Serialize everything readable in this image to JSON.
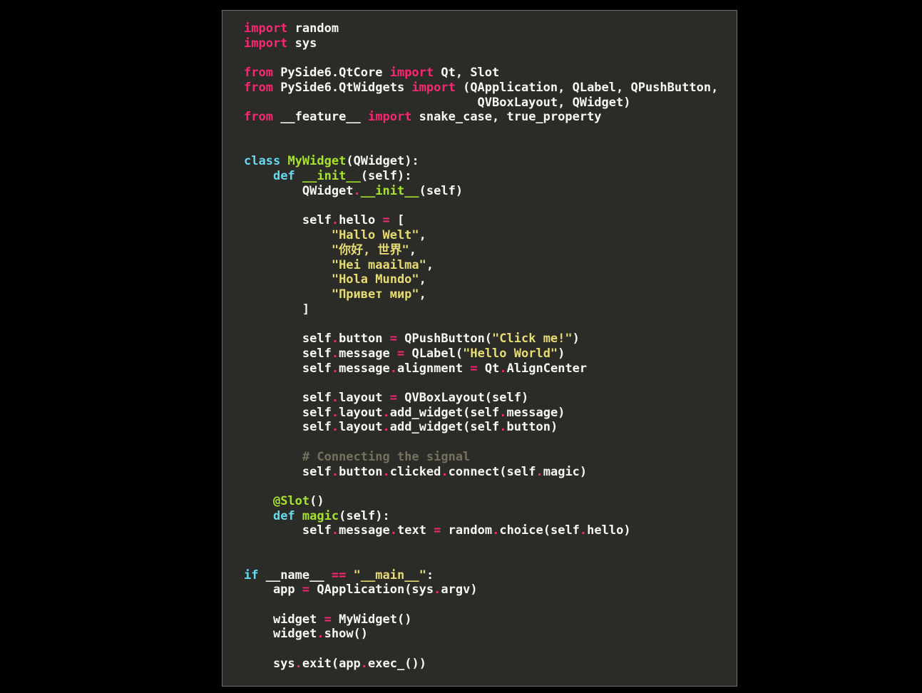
{
  "window": {
    "background_color": "#000000",
    "panel_background_color": "#2b2b28",
    "panel_border_color": "#6f706a"
  },
  "theme": {
    "name": "monokai",
    "keyword_color": "#f92672",
    "control_color": "#66d9ef",
    "function_name_color": "#a6e22e",
    "string_color": "#e6db74",
    "comment_color": "#75715e",
    "plain_color": "#f8f8f2"
  },
  "code": {
    "language": "python",
    "lines": [
      [
        {
          "t": "import",
          "c": "kw"
        },
        {
          "t": " random",
          "c": "pln"
        }
      ],
      [
        {
          "t": "import",
          "c": "kw"
        },
        {
          "t": " sys",
          "c": "pln"
        }
      ],
      [],
      [
        {
          "t": "from",
          "c": "kw"
        },
        {
          "t": " PySide6.QtCore ",
          "c": "pln"
        },
        {
          "t": "import",
          "c": "kw"
        },
        {
          "t": " Qt, Slot",
          "c": "pln"
        }
      ],
      [
        {
          "t": "from",
          "c": "kw"
        },
        {
          "t": " PySide6.QtWidgets ",
          "c": "pln"
        },
        {
          "t": "import",
          "c": "kw"
        },
        {
          "t": " (QApplication, QLabel, QPushButton,",
          "c": "pln"
        }
      ],
      [
        {
          "t": "                                QVBoxLayout, QWidget)",
          "c": "pln"
        }
      ],
      [
        {
          "t": "from",
          "c": "kw"
        },
        {
          "t": " __feature__ ",
          "c": "pln"
        },
        {
          "t": "import",
          "c": "kw"
        },
        {
          "t": " snake_case, true_property",
          "c": "pln"
        }
      ],
      [],
      [],
      [
        {
          "t": "class",
          "c": "ctl"
        },
        {
          "t": " ",
          "c": "pln"
        },
        {
          "t": "MyWidget",
          "c": "name"
        },
        {
          "t": "(QWidget):",
          "c": "pln"
        }
      ],
      [
        {
          "t": "    ",
          "c": "pln"
        },
        {
          "t": "def",
          "c": "ctl"
        },
        {
          "t": " ",
          "c": "pln"
        },
        {
          "t": "__init__",
          "c": "name"
        },
        {
          "t": "(self):",
          "c": "pln"
        }
      ],
      [
        {
          "t": "        QWidget",
          "c": "pln"
        },
        {
          "t": ".",
          "c": "kw"
        },
        {
          "t": "__init__",
          "c": "name"
        },
        {
          "t": "(self)",
          "c": "pln"
        }
      ],
      [],
      [
        {
          "t": "        self",
          "c": "pln"
        },
        {
          "t": ".",
          "c": "kw"
        },
        {
          "t": "hello ",
          "c": "pln"
        },
        {
          "t": "=",
          "c": "kw"
        },
        {
          "t": " [",
          "c": "pln"
        }
      ],
      [
        {
          "t": "            ",
          "c": "pln"
        },
        {
          "t": "\"Hallo Welt\"",
          "c": "str"
        },
        {
          "t": ",",
          "c": "pln"
        }
      ],
      [
        {
          "t": "            ",
          "c": "pln"
        },
        {
          "t": "\"你好, 世界\"",
          "c": "str"
        },
        {
          "t": ",",
          "c": "pln"
        }
      ],
      [
        {
          "t": "            ",
          "c": "pln"
        },
        {
          "t": "\"Hei maailma\"",
          "c": "str"
        },
        {
          "t": ",",
          "c": "pln"
        }
      ],
      [
        {
          "t": "            ",
          "c": "pln"
        },
        {
          "t": "\"Hola Mundo\"",
          "c": "str"
        },
        {
          "t": ",",
          "c": "pln"
        }
      ],
      [
        {
          "t": "            ",
          "c": "pln"
        },
        {
          "t": "\"Привет мир\"",
          "c": "str"
        },
        {
          "t": ",",
          "c": "pln"
        }
      ],
      [
        {
          "t": "        ]",
          "c": "pln"
        }
      ],
      [],
      [
        {
          "t": "        self",
          "c": "pln"
        },
        {
          "t": ".",
          "c": "kw"
        },
        {
          "t": "button ",
          "c": "pln"
        },
        {
          "t": "=",
          "c": "kw"
        },
        {
          "t": " QPushButton(",
          "c": "pln"
        },
        {
          "t": "\"Click me!\"",
          "c": "str"
        },
        {
          "t": ")",
          "c": "pln"
        }
      ],
      [
        {
          "t": "        self",
          "c": "pln"
        },
        {
          "t": ".",
          "c": "kw"
        },
        {
          "t": "message ",
          "c": "pln"
        },
        {
          "t": "=",
          "c": "kw"
        },
        {
          "t": " QLabel(",
          "c": "pln"
        },
        {
          "t": "\"Hello World\"",
          "c": "str"
        },
        {
          "t": ")",
          "c": "pln"
        }
      ],
      [
        {
          "t": "        self",
          "c": "pln"
        },
        {
          "t": ".",
          "c": "kw"
        },
        {
          "t": "message",
          "c": "pln"
        },
        {
          "t": ".",
          "c": "kw"
        },
        {
          "t": "alignment ",
          "c": "pln"
        },
        {
          "t": "=",
          "c": "kw"
        },
        {
          "t": " Qt",
          "c": "pln"
        },
        {
          "t": ".",
          "c": "kw"
        },
        {
          "t": "AlignCenter",
          "c": "pln"
        }
      ],
      [],
      [
        {
          "t": "        self",
          "c": "pln"
        },
        {
          "t": ".",
          "c": "kw"
        },
        {
          "t": "layout ",
          "c": "pln"
        },
        {
          "t": "=",
          "c": "kw"
        },
        {
          "t": " QVBoxLayout(self)",
          "c": "pln"
        }
      ],
      [
        {
          "t": "        self",
          "c": "pln"
        },
        {
          "t": ".",
          "c": "kw"
        },
        {
          "t": "layout",
          "c": "pln"
        },
        {
          "t": ".",
          "c": "kw"
        },
        {
          "t": "add_widget(self",
          "c": "pln"
        },
        {
          "t": ".",
          "c": "kw"
        },
        {
          "t": "message)",
          "c": "pln"
        }
      ],
      [
        {
          "t": "        self",
          "c": "pln"
        },
        {
          "t": ".",
          "c": "kw"
        },
        {
          "t": "layout",
          "c": "pln"
        },
        {
          "t": ".",
          "c": "kw"
        },
        {
          "t": "add_widget(self",
          "c": "pln"
        },
        {
          "t": ".",
          "c": "kw"
        },
        {
          "t": "button)",
          "c": "pln"
        }
      ],
      [],
      [
        {
          "t": "        ",
          "c": "pln"
        },
        {
          "t": "# Connecting the signal",
          "c": "cmt"
        }
      ],
      [
        {
          "t": "        self",
          "c": "pln"
        },
        {
          "t": ".",
          "c": "kw"
        },
        {
          "t": "button",
          "c": "pln"
        },
        {
          "t": ".",
          "c": "kw"
        },
        {
          "t": "clicked",
          "c": "pln"
        },
        {
          "t": ".",
          "c": "kw"
        },
        {
          "t": "connect(self",
          "c": "pln"
        },
        {
          "t": ".",
          "c": "kw"
        },
        {
          "t": "magic)",
          "c": "pln"
        }
      ],
      [],
      [
        {
          "t": "    ",
          "c": "pln"
        },
        {
          "t": "@Slot",
          "c": "name"
        },
        {
          "t": "()",
          "c": "pln"
        }
      ],
      [
        {
          "t": "    ",
          "c": "pln"
        },
        {
          "t": "def",
          "c": "ctl"
        },
        {
          "t": " ",
          "c": "pln"
        },
        {
          "t": "magic",
          "c": "name"
        },
        {
          "t": "(self):",
          "c": "pln"
        }
      ],
      [
        {
          "t": "        self",
          "c": "pln"
        },
        {
          "t": ".",
          "c": "kw"
        },
        {
          "t": "message",
          "c": "pln"
        },
        {
          "t": ".",
          "c": "kw"
        },
        {
          "t": "text ",
          "c": "pln"
        },
        {
          "t": "=",
          "c": "kw"
        },
        {
          "t": " random",
          "c": "pln"
        },
        {
          "t": ".",
          "c": "kw"
        },
        {
          "t": "choice(self",
          "c": "pln"
        },
        {
          "t": ".",
          "c": "kw"
        },
        {
          "t": "hello)",
          "c": "pln"
        }
      ],
      [],
      [],
      [
        {
          "t": "if",
          "c": "ctl"
        },
        {
          "t": " __name__ ",
          "c": "pln"
        },
        {
          "t": "==",
          "c": "kw"
        },
        {
          "t": " ",
          "c": "pln"
        },
        {
          "t": "\"__main__\"",
          "c": "str"
        },
        {
          "t": ":",
          "c": "pln"
        }
      ],
      [
        {
          "t": "    app ",
          "c": "pln"
        },
        {
          "t": "=",
          "c": "kw"
        },
        {
          "t": " QApplication(sys",
          "c": "pln"
        },
        {
          "t": ".",
          "c": "kw"
        },
        {
          "t": "argv)",
          "c": "pln"
        }
      ],
      [],
      [
        {
          "t": "    widget ",
          "c": "pln"
        },
        {
          "t": "=",
          "c": "kw"
        },
        {
          "t": " MyWidget()",
          "c": "pln"
        }
      ],
      [
        {
          "t": "    widget",
          "c": "pln"
        },
        {
          "t": ".",
          "c": "kw"
        },
        {
          "t": "show()",
          "c": "pln"
        }
      ],
      [],
      [
        {
          "t": "    sys",
          "c": "pln"
        },
        {
          "t": ".",
          "c": "kw"
        },
        {
          "t": "exit(app",
          "c": "pln"
        },
        {
          "t": ".",
          "c": "kw"
        },
        {
          "t": "exec_())",
          "c": "pln"
        }
      ]
    ]
  }
}
